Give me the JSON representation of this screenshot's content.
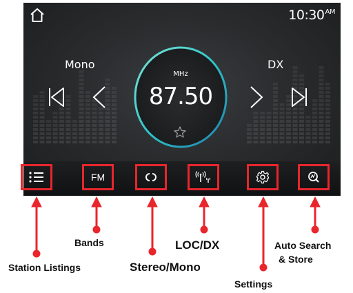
{
  "status_bar": {
    "time": "10:30",
    "time_suffix": "AM"
  },
  "radio": {
    "left_label": "Mono",
    "right_label": "DX",
    "unit": "MHz",
    "frequency": "87.50"
  },
  "toolbar": {
    "fm_label": "FM"
  },
  "callouts": {
    "bands": "Bands",
    "station_listings": "Station Listings",
    "stereo_mono": "Stereo/Mono",
    "loc_dx": "LOC/DX",
    "settings": "Settings",
    "auto_search_line1": "Auto Search",
    "auto_search_line2": "& Store"
  },
  "colors": {
    "highlight_box": "#e8262c",
    "dial_ring": "#3fd3c2",
    "screen_bg": "#2a2c2e"
  },
  "icons": [
    "home-icon",
    "skip-previous-icon",
    "seek-previous-icon",
    "seek-next-icon",
    "skip-next-icon",
    "favorite-star-icon",
    "list-icon",
    "stereo-icon",
    "antenna-icon",
    "gear-icon",
    "search-icon"
  ]
}
